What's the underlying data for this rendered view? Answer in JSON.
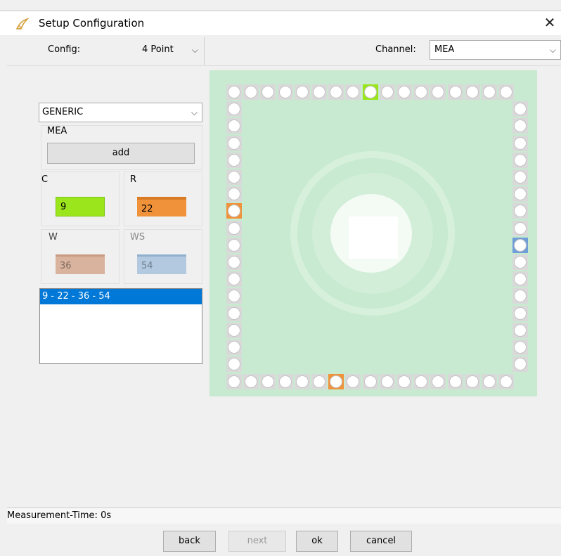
{
  "window": {
    "title": "Setup Configuration",
    "close_glyph": "✕"
  },
  "config": {
    "label": "Config:",
    "value": "4 Point",
    "channel_label": "Channel:",
    "channel_value": "MEA"
  },
  "left": {
    "profile": "GENERIC",
    "group_title": "MEA",
    "add_label": "add",
    "fields": [
      {
        "label": "C",
        "value": "9",
        "color": "#9be51d"
      },
      {
        "label": "R",
        "value": "22",
        "color": "#f0923a"
      },
      {
        "label": "W",
        "value": "36",
        "color": "#d9b39d"
      },
      {
        "label": "WS",
        "value": "54",
        "color": "#b3c9df"
      }
    ],
    "list_items": [
      "9 - 22 - 36 - 54"
    ]
  },
  "board": {
    "highlight_colors": {
      "green": "#9be51d",
      "orange": "#f0923a",
      "blue": "#6f9ed8"
    }
  },
  "status": {
    "text": "Measurement-Time: 0s"
  },
  "buttons": {
    "back": "back",
    "next": "next",
    "ok": "ok",
    "cancel": "cancel"
  }
}
